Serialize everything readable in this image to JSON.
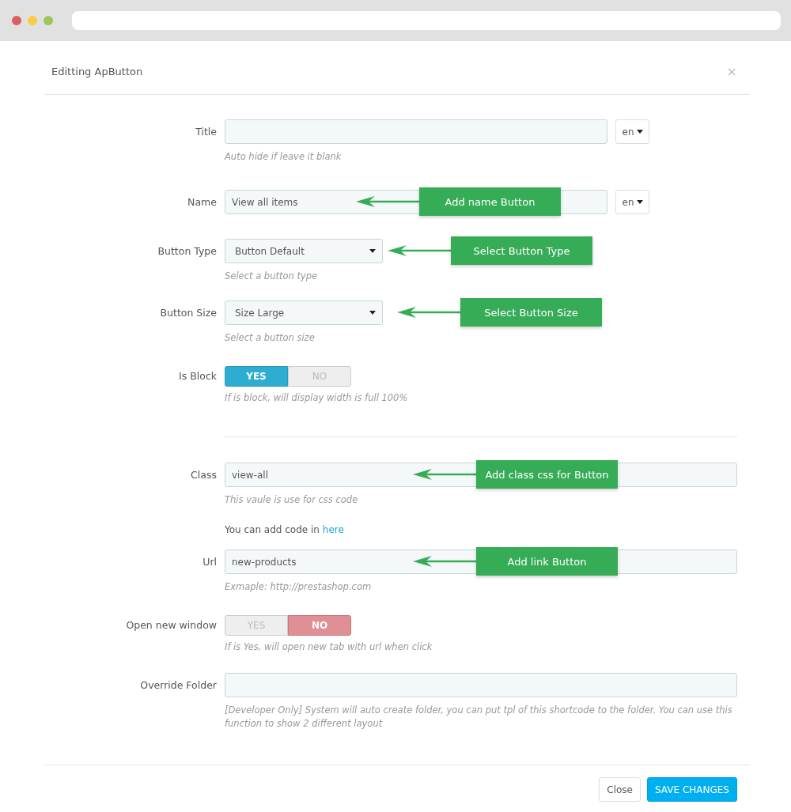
{
  "dialog": {
    "title": "Editting ApButton",
    "close": "×"
  },
  "fields": [
    {
      "kind": "text",
      "label": "Title",
      "lang": "en",
      "help": "Auto hide if leave it blank"
    },
    {
      "kind": "text",
      "label": "Name",
      "value": "View all items",
      "lang": "en",
      "callout": "Add name Button"
    },
    {
      "kind": "select",
      "label": "Button Type",
      "value": "Button Default",
      "help": "Select a button type",
      "callout": "Select Button Type"
    },
    {
      "kind": "select",
      "label": "Button Size",
      "value": "Size Large",
      "help": "Select a button size",
      "callout": "Select Button Size"
    },
    {
      "kind": "toggle",
      "label": "Is Block",
      "options": [
        {
          "label": "YES",
          "kind": "positive",
          "selected": true
        },
        {
          "label": "NO",
          "kind": "negative",
          "selected": false
        }
      ],
      "help": "If is block, will display width is full 100%"
    },
    {
      "kind": "divider"
    },
    {
      "kind": "text",
      "label": "Class",
      "value": "view-all",
      "help": "This vaule is use for css code",
      "callout": "Add class css for Button"
    },
    {
      "kind": "note",
      "text": "You can add code in",
      "link": "here"
    },
    {
      "kind": "text",
      "label": "Url",
      "value": "new-products",
      "help": "Exmaple: http://prestashop.com",
      "callout": "Add link Button"
    },
    {
      "kind": "toggle",
      "label": "Open new window",
      "options": [
        {
          "label": "YES",
          "kind": "positive",
          "selected": false
        },
        {
          "label": "NO",
          "kind": "negative",
          "selected": true
        }
      ],
      "help": "If is Yes, will open new tab with url when click"
    },
    {
      "kind": "text",
      "label": "Override Folder",
      "help": "[Developer Only] System will auto create folder, you can put tpl of this shortcode to the folder. You can use this function to show 2 different layout"
    }
  ],
  "footer": {
    "buttons": [
      {
        "label": "Close",
        "kind": "default"
      },
      {
        "label": "SAVE CHANGES",
        "kind": "primary"
      }
    ]
  }
}
